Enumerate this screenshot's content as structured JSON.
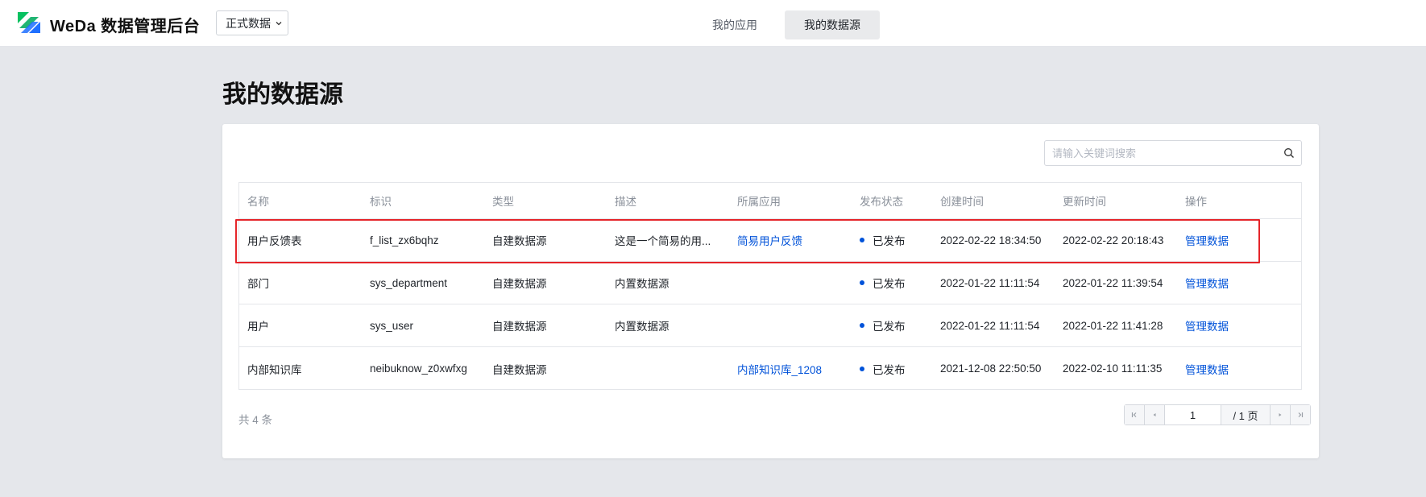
{
  "header": {
    "brand": "WeDa 数据管理后台",
    "env_select": "正式数据",
    "nav": [
      "我的应用",
      "我的数据源"
    ],
    "active_nav": "我的数据源"
  },
  "page": {
    "title": "我的数据源"
  },
  "search": {
    "placeholder": "请输入关键词搜索"
  },
  "table": {
    "columns": [
      "名称",
      "标识",
      "类型",
      "描述",
      "所属应用",
      "发布状态",
      "创建时间",
      "更新时间",
      "操作"
    ],
    "rows": [
      {
        "name": "用户反馈表",
        "id": "f_list_zx6bqhz",
        "type": "自建数据源",
        "desc": "这是一个简易的用...",
        "app": "简易用户反馈",
        "status": "已发布",
        "created": "2022-02-22 18:34:50",
        "updated": "2022-02-22 20:18:43",
        "action": "管理数据"
      },
      {
        "name": "部门",
        "id": "sys_department",
        "type": "自建数据源",
        "desc": "内置数据源",
        "app": "",
        "status": "已发布",
        "created": "2022-01-22 11:11:54",
        "updated": "2022-01-22 11:39:54",
        "action": "管理数据"
      },
      {
        "name": "用户",
        "id": "sys_user",
        "type": "自建数据源",
        "desc": "内置数据源",
        "app": "",
        "status": "已发布",
        "created": "2022-01-22 11:11:54",
        "updated": "2022-01-22 11:41:28",
        "action": "管理数据"
      },
      {
        "name": "内部知识库",
        "id": "neibuknow_z0xwfxg",
        "type": "自建数据源",
        "desc": "",
        "app": "内部知识库_1208",
        "status": "已发布",
        "created": "2021-12-08 22:50:50",
        "updated": "2022-02-10 11:11:35",
        "action": "管理数据"
      }
    ]
  },
  "footer": {
    "total": "共 4 条",
    "page_value": "1",
    "page_total": "/ 1 页"
  },
  "colors": {
    "accent": "#0052d9",
    "highlight": "#e5252a",
    "logo_green": "#07c160",
    "logo_blue": "#1e6fff"
  },
  "icons": [
    "weda-logo-icon",
    "chevron-down-icon",
    "search-icon",
    "first-page-icon",
    "prev-page-icon",
    "next-page-icon",
    "last-page-icon"
  ]
}
